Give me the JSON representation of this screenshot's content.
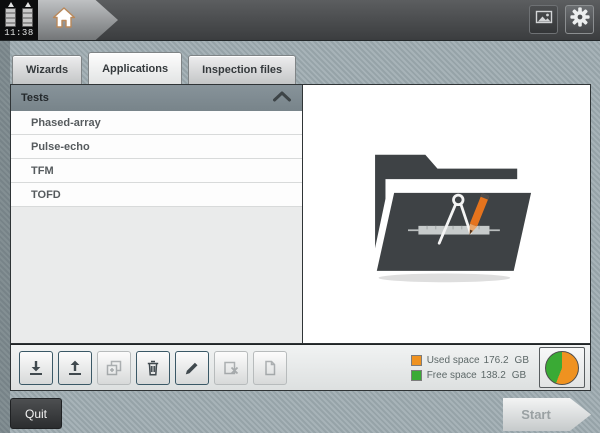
{
  "topbar": {
    "time": "11:38",
    "home_icon": "home-icon",
    "screenshot_icon": "image-icon",
    "settings_icon": "gear-icon"
  },
  "tabs": [
    {
      "label": "Wizards",
      "active": false
    },
    {
      "label": "Applications",
      "active": true
    },
    {
      "label": "Inspection files",
      "active": false
    }
  ],
  "tests_panel": {
    "header": "Tests",
    "collapse_icon": "chevron-up-icon",
    "items": [
      "Phased-array",
      "Pulse-echo",
      "TFM",
      "TOFD"
    ]
  },
  "preview": {
    "icon": "applications-folder-icon"
  },
  "toolbar": {
    "buttons": [
      {
        "name": "import",
        "icon": "download-icon",
        "enabled": true
      },
      {
        "name": "export",
        "icon": "upload-icon",
        "enabled": true
      },
      {
        "name": "copy",
        "icon": "copy-icon",
        "enabled": false
      },
      {
        "name": "delete",
        "icon": "trash-icon",
        "enabled": true
      },
      {
        "name": "edit",
        "icon": "pencil-icon",
        "enabled": true
      },
      {
        "name": "cut-file",
        "icon": "file-cut-icon",
        "enabled": false
      },
      {
        "name": "new-document",
        "icon": "document-icon",
        "enabled": false
      }
    ]
  },
  "storage": {
    "used_label": "Used space",
    "used_value": "176.2",
    "used_unit": "GB",
    "free_label": "Free space",
    "free_value": "138.2",
    "free_unit": "GB",
    "used_color": "#ef9220",
    "free_color": "#3aaa35",
    "used_pct": 56
  },
  "footer": {
    "quit_label": "Quit",
    "start_label": "Start"
  }
}
